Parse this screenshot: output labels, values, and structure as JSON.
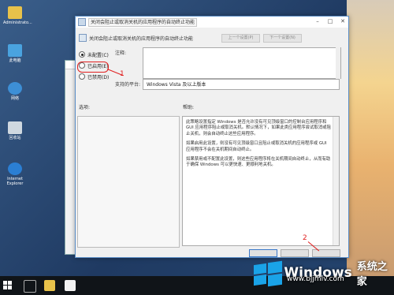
{
  "desktop": {
    "icons": [
      {
        "label": "Administrato...",
        "icon": "user-folder-icon",
        "color": "#e8c24a"
      },
      {
        "label": "此电脑",
        "icon": "this-pc-icon",
        "color": "#4aa3df"
      },
      {
        "label": "网络",
        "icon": "network-icon",
        "color": "#3d8fd6"
      },
      {
        "label": "回收站",
        "icon": "recycle-bin-icon",
        "color": "#cfd8e0"
      },
      {
        "label": "Internet Explorer",
        "icon": "ie-icon",
        "color": "#2b7fd4"
      }
    ]
  },
  "dialog": {
    "window_title": "关闭会阻止或取消关机的应用程序的自动终止功能",
    "header_title": "关闭会阻止或取消关机的应用程序的自动终止功能",
    "prev_setting": "上一个设置(P)",
    "next_setting": "下一个设置(N)",
    "radio_options": [
      {
        "label": "未配置(C)",
        "checked": true
      },
      {
        "label": "已启用(E)",
        "checked": false
      },
      {
        "label": "已禁用(D)",
        "checked": false
      }
    ],
    "comment_label": "注释:",
    "platform_label": "支持的平台:",
    "platform_value": "Windows Vista 及以上版本",
    "options_label": "选项:",
    "help_label": "帮助:",
    "help_paragraphs": [
      "此策略设置指定 Windows 是否允许没有可见顶级窗口的控制台应用程序和 GUI 应用程序阻止或取消关机。默认情况下，如果此类应用程序尝试取消或阻止关机，则会自动终止这些应用程序。",
      "如果启用此设置，则没有可见顶级窗口且阻止或取消关机的应用程序或 GUI 应用程序不会在关机期间自动终止。",
      "如果禁用或不配置此设置，则这些应用程序将在关机期间自动终止，从而有助于确保 Windows 可以更快速、更顺利地关机。"
    ]
  },
  "annotations": {
    "step1": "1",
    "step2": "2",
    "highlight_color": "#e02020"
  },
  "watermark": {
    "brand": "Windows",
    "suffix": "系统之家",
    "url": "www.bjjmlv.com"
  }
}
